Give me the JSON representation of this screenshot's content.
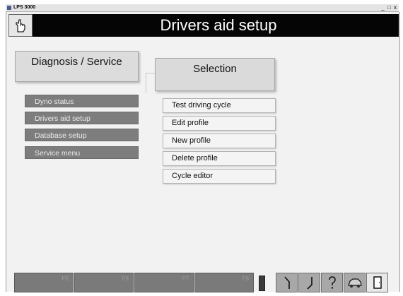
{
  "window": {
    "title": "LPS 3000",
    "controls": "_ □ x"
  },
  "header": {
    "title": "Drivers aid setup",
    "icon": "hand-pointer-icon"
  },
  "left_panel": {
    "title": "Diagnosis / Service",
    "items": [
      {
        "label": "Dyno status"
      },
      {
        "label": "Drivers aid setup"
      },
      {
        "label": "Database setup"
      },
      {
        "label": "Service menu"
      }
    ]
  },
  "selection": {
    "title": "Selection",
    "items": [
      {
        "label": "Test driving cycle"
      },
      {
        "label": "Edit profile"
      },
      {
        "label": "New profile"
      },
      {
        "label": "Delete profile"
      },
      {
        "label": "Cycle editor"
      }
    ]
  },
  "function_bar": {
    "keys": [
      {
        "label": "F5"
      },
      {
        "label": "F6"
      },
      {
        "label": "F7"
      },
      {
        "label": "F8"
      }
    ],
    "tools": [
      {
        "icon": "ramp-up-icon"
      },
      {
        "icon": "ramp-down-icon"
      },
      {
        "icon": "help-icon"
      },
      {
        "icon": "car-icon"
      },
      {
        "icon": "exit-door-icon"
      }
    ]
  }
}
